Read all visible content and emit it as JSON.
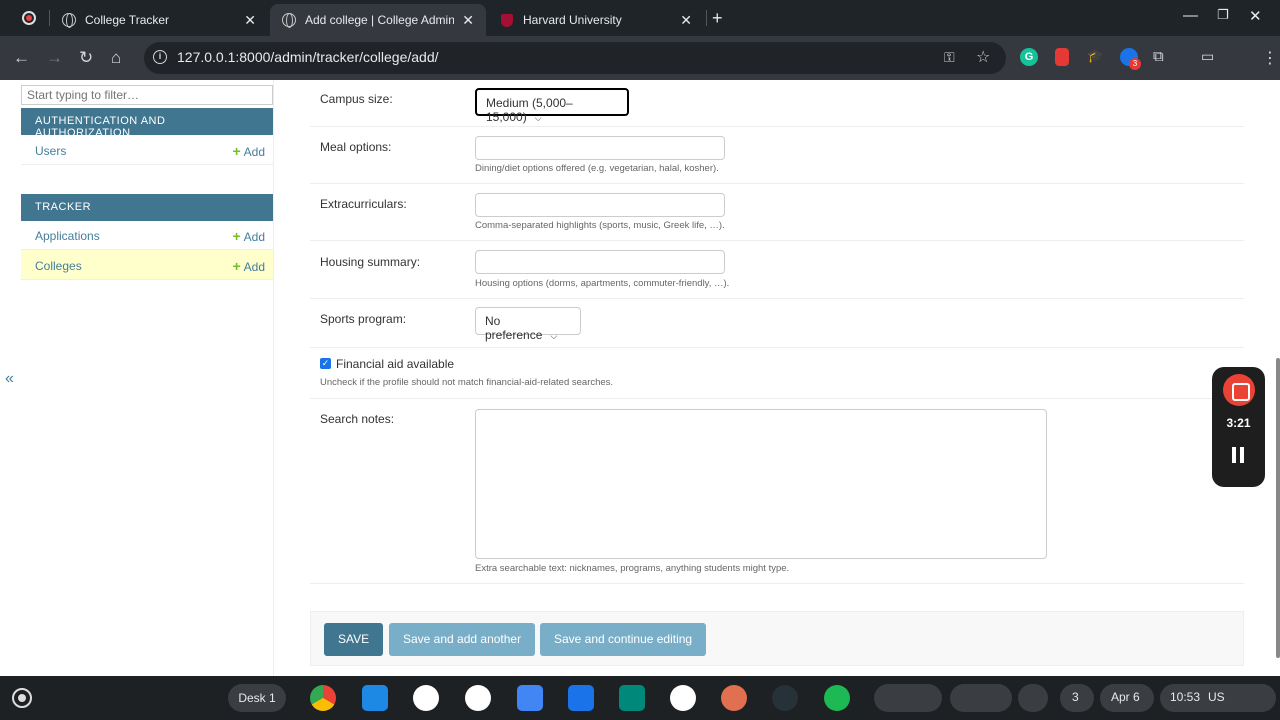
{
  "browser": {
    "tabs": [
      {
        "title": "College Tracker",
        "active": false
      },
      {
        "title": "Add college | College Administr",
        "active": true
      },
      {
        "title": "Harvard University",
        "active": false
      }
    ],
    "url": "127.0.0.1:8000/admin/tracker/college/add/",
    "extension_badge": "3"
  },
  "sidebar": {
    "filter_placeholder": "Start typing to filter…",
    "modules": [
      {
        "header": "Authentication and Authorization",
        "items": [
          {
            "label": "Users",
            "add": "Add"
          }
        ]
      },
      {
        "header": "Tracker",
        "items": [
          {
            "label": "Applications",
            "add": "Add"
          },
          {
            "label": "Colleges",
            "add": "Add",
            "current": true
          }
        ]
      }
    ],
    "collapse_glyph": "«"
  },
  "form": {
    "campus_size": {
      "label": "Campus size:",
      "value": "Medium (5,000–15,000)"
    },
    "meal_options": {
      "label": "Meal options:",
      "value": "",
      "help": "Dining/diet options offered (e.g. vegetarian, halal, kosher)."
    },
    "extracurriculars": {
      "label": "Extracurriculars:",
      "value": "",
      "help": "Comma-separated highlights (sports, music, Greek life, …)."
    },
    "housing_summary": {
      "label": "Housing summary:",
      "value": "",
      "help": "Housing options (dorms, apartments, commuter-friendly, …)."
    },
    "sports_program": {
      "label": "Sports program:",
      "value": "No preference"
    },
    "financial_aid": {
      "label": "Financial aid available",
      "checked": true,
      "help": "Uncheck if the profile should not match financial-aid-related searches."
    },
    "search_notes": {
      "label": "Search notes:",
      "value": "",
      "help": "Extra searchable text: nicknames, programs, anything students might type."
    }
  },
  "submit": {
    "save": "SAVE",
    "save_add_another": "Save and add another",
    "save_continue": "Save and continue editing"
  },
  "recording": {
    "time": "3:21"
  },
  "shelf": {
    "desk": "Desk 1",
    "notification_count": "3",
    "date": "Apr 6",
    "time": "10:53",
    "locale": "US"
  }
}
